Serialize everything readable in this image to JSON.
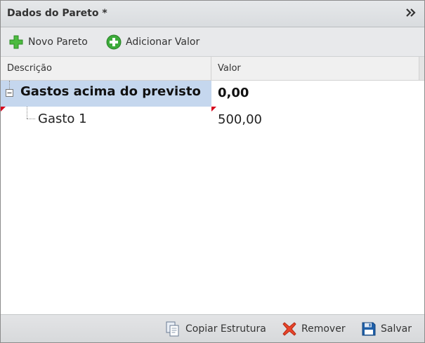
{
  "panel": {
    "title": "Dados do Pareto *",
    "collapse_glyph": "»"
  },
  "toolbar": {
    "new_pareto_label": "Novo Pareto",
    "new_pareto_icon": "green-plus-icon",
    "add_value_label": "Adicionar Valor",
    "add_value_icon": "green-circle-plus-icon"
  },
  "grid": {
    "columns": [
      "Descrição",
      "Valor"
    ],
    "rows": [
      {
        "description": "Gastos acima do previsto",
        "value": "0,00",
        "level": 0,
        "expanded": true,
        "selected": true
      },
      {
        "description": "Gasto 1",
        "value": "500,00",
        "level": 1,
        "expanded": false,
        "selected": false
      }
    ]
  },
  "footer": {
    "copy_label": "Copiar Estrutura",
    "copy_icon": "copy-document-icon",
    "remove_label": "Remover",
    "remove_icon": "red-x-icon",
    "save_label": "Salvar",
    "save_icon": "floppy-disk-icon"
  },
  "colors": {
    "selection": "#c5d7ee",
    "dirty_marker": "#d6001c",
    "accent_green": "#3cb043",
    "accent_red": "#e8442a",
    "accent_blue": "#1f5fa8"
  }
}
